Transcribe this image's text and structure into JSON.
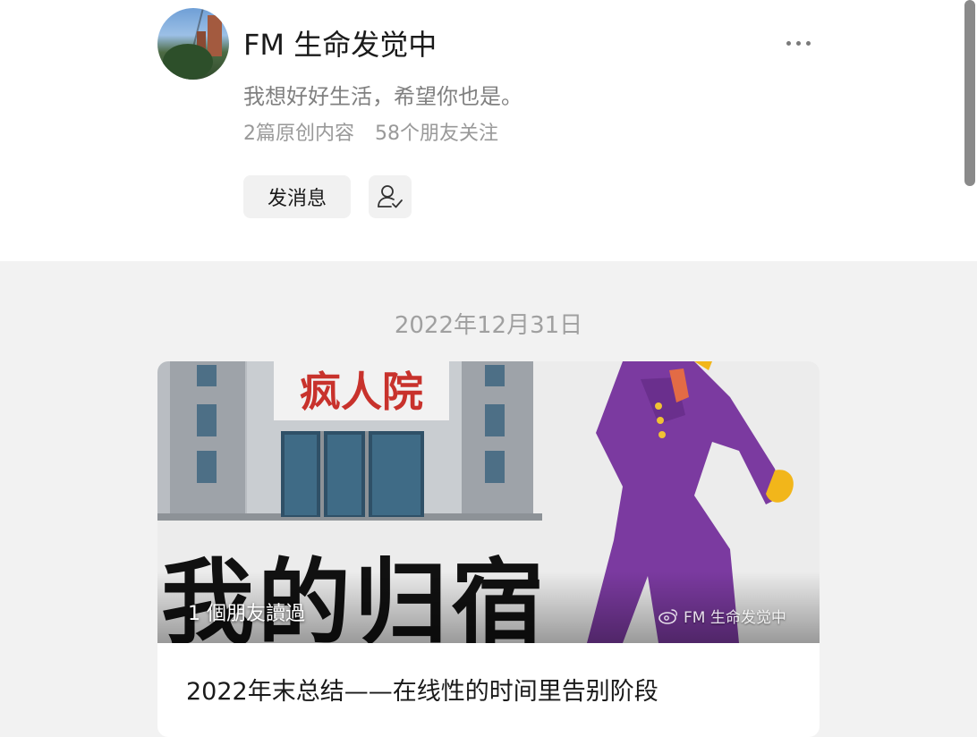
{
  "profile": {
    "name": "FM 生命发觉中",
    "bio": "我想好好生活，希望你也是。",
    "original_count": "2篇原创内容",
    "followers": "58个朋友关注",
    "message_button": "发消息",
    "more_icon": "more-horizontal-icon",
    "follow_icon": "user-check-icon"
  },
  "feed": {
    "date": "2022年12月31日",
    "article": {
      "cover_sign": "疯人院",
      "cover_caption": "我的归宿",
      "readers": "1 個朋友讀過",
      "watermark": "FM 生命发觉中",
      "title": "2022年末总结——在线性的时间里告别阶段"
    }
  },
  "colors": {
    "page_bg": "#f2f2f2",
    "card_bg": "#ffffff",
    "suit_purple": "#7b3aa0",
    "sign_red": "#c8322c"
  }
}
